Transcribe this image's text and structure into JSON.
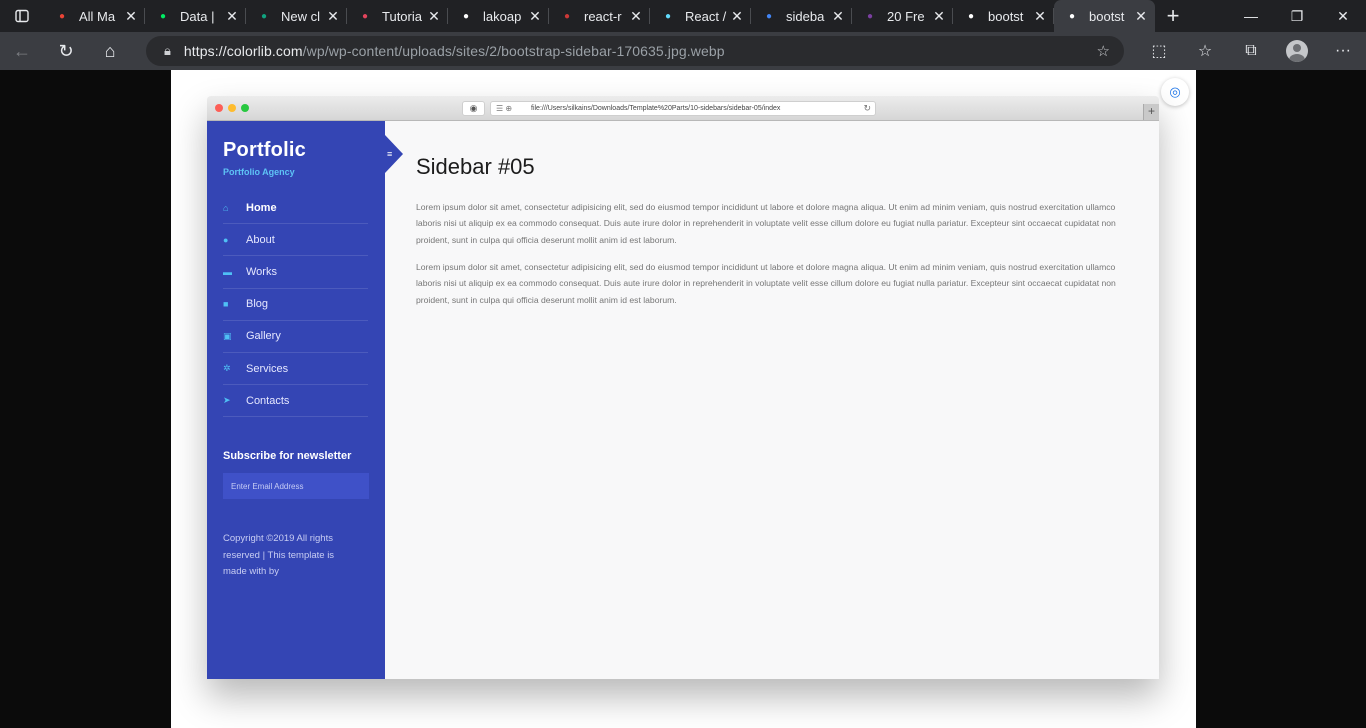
{
  "browser": {
    "tabs": [
      {
        "title": "All Ma",
        "favicon": "gmail-icon",
        "color": "#ea4335"
      },
      {
        "title": "Data |",
        "favicon": "mongodb-leaf-icon",
        "color": "#00ed64"
      },
      {
        "title": "New cl",
        "favicon": "chatgpt-icon",
        "color": "#10a37f"
      },
      {
        "title": "Tutoria",
        "favicon": "tutorial-icon",
        "color": "#e2445c"
      },
      {
        "title": "lakoap",
        "favicon": "github-icon",
        "color": "#ffffff"
      },
      {
        "title": "react-r",
        "favicon": "npm-icon",
        "color": "#cb3837"
      },
      {
        "title": "React /",
        "favicon": "react-icon",
        "color": "#61dafb"
      },
      {
        "title": "sideba",
        "favicon": "google-icon",
        "color": "#4285f4"
      },
      {
        "title": "20 Fre",
        "favicon": "colorlib-icon",
        "color": "#7a3fa0"
      },
      {
        "title": "bootst",
        "favicon": "wordpress-icon",
        "color": "#ffffff"
      },
      {
        "title": "bootst",
        "favicon": "wordpress-icon",
        "color": "#ffffff"
      }
    ],
    "url_host": "https://colorlib.com",
    "url_path": "/wp/wp-content/uploads/sites/2/bootstrap-sidebar-170635.jpg.webp"
  },
  "mock_browser": {
    "url": "file:///Users/silkains/Downloads/Template%20Parts/10-sidebars/sidebar-05/index"
  },
  "sidebar": {
    "brand": "Portfolic",
    "tagline": "Portfolio Agency",
    "nav": [
      {
        "label": "Home",
        "icon": "home-icon",
        "glyph": "⌂"
      },
      {
        "label": "About",
        "icon": "user-icon",
        "glyph": "●"
      },
      {
        "label": "Works",
        "icon": "briefcase-icon",
        "glyph": "▬"
      },
      {
        "label": "Blog",
        "icon": "sticky-note-icon",
        "glyph": "■"
      },
      {
        "label": "Gallery",
        "icon": "suitcase-icon",
        "glyph": "▣"
      },
      {
        "label": "Services",
        "icon": "cogs-icon",
        "glyph": "✲"
      },
      {
        "label": "Contacts",
        "icon": "paper-plane-icon",
        "glyph": "➤"
      }
    ],
    "subscribe_title": "Subscribe for newsletter",
    "email_placeholder": "Enter Email Address",
    "copyright": "Copyright ©2019 All rights reserved | This template is made with by"
  },
  "content": {
    "title": "Sidebar #05",
    "paragraphs": [
      "Lorem ipsum dolor sit amet, consectetur adipisicing elit, sed do eiusmod tempor incididunt ut labore et dolore magna aliqua. Ut enim ad minim veniam, quis nostrud exercitation ullamco laboris nisi ut aliquip ex ea commodo consequat. Duis aute irure dolor in reprehenderit in voluptate velit esse cillum dolore eu fugiat nulla pariatur. Excepteur sint occaecat cupidatat non proident, sunt in culpa qui officia deserunt mollit anim id est laborum.",
      "Lorem ipsum dolor sit amet, consectetur adipisicing elit, sed do eiusmod tempor incididunt ut labore et dolore magna aliqua. Ut enim ad minim veniam, quis nostrud exercitation ullamco laboris nisi ut aliquip ex ea commodo consequat. Duis aute irure dolor in reprehenderit in voluptate velit esse cillum dolore eu fugiat nulla pariatur. Excepteur sint occaecat cupidatat non proident, sunt in culpa qui officia deserunt mollit anim id est laborum."
    ]
  },
  "colors": {
    "sidebar_bg": "#3445b4",
    "accent": "#4fc0f5",
    "browser_frame": "#202124"
  }
}
